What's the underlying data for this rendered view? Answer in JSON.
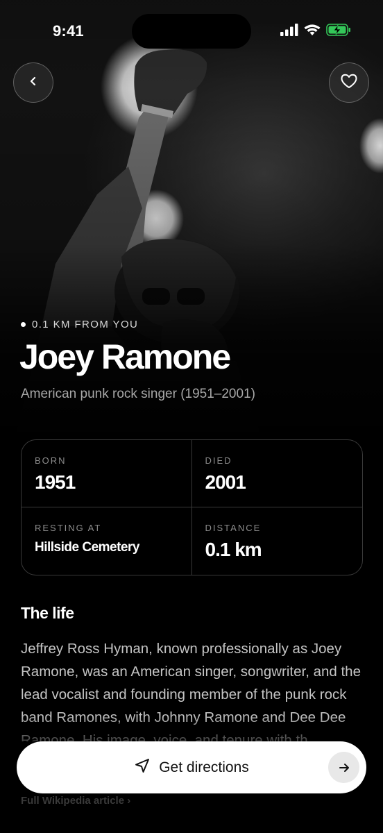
{
  "status_bar": {
    "time": "9:41",
    "icons": [
      "cellular-signal-icon",
      "wifi-icon",
      "battery-charging-icon"
    ],
    "battery_color": "#34C759"
  },
  "header": {
    "back_icon": "chevron-left-icon",
    "favorite_icon": "heart-icon"
  },
  "hero": {
    "distance": "0.1 KM FROM YOU",
    "name": "Joey Ramone",
    "subtitle": "American punk rock singer (1951–2001)"
  },
  "stats": [
    {
      "label": "BORN",
      "value": "1951"
    },
    {
      "label": "DIED",
      "value": "2001"
    },
    {
      "label": "RESTING AT",
      "value": "Hillside Cemetery"
    },
    {
      "label": "DISTANCE",
      "value": "0.1 km"
    }
  ],
  "life": {
    "title": "The life",
    "bio": "Jeffrey Ross Hyman, known professionally as Joey Ramone, was an American singer, songwriter, and the lead vocalist and founding member of the punk rock band Ramones, with Johnny Ramone and Dee Dee Ramone. His image, voice, and tenure with th...",
    "wiki_link": "Full Wikipedia article ›"
  },
  "cta": {
    "label": "Get directions",
    "icon": "navigation-arrow-icon",
    "trailing_icon": "arrow-right-icon"
  }
}
